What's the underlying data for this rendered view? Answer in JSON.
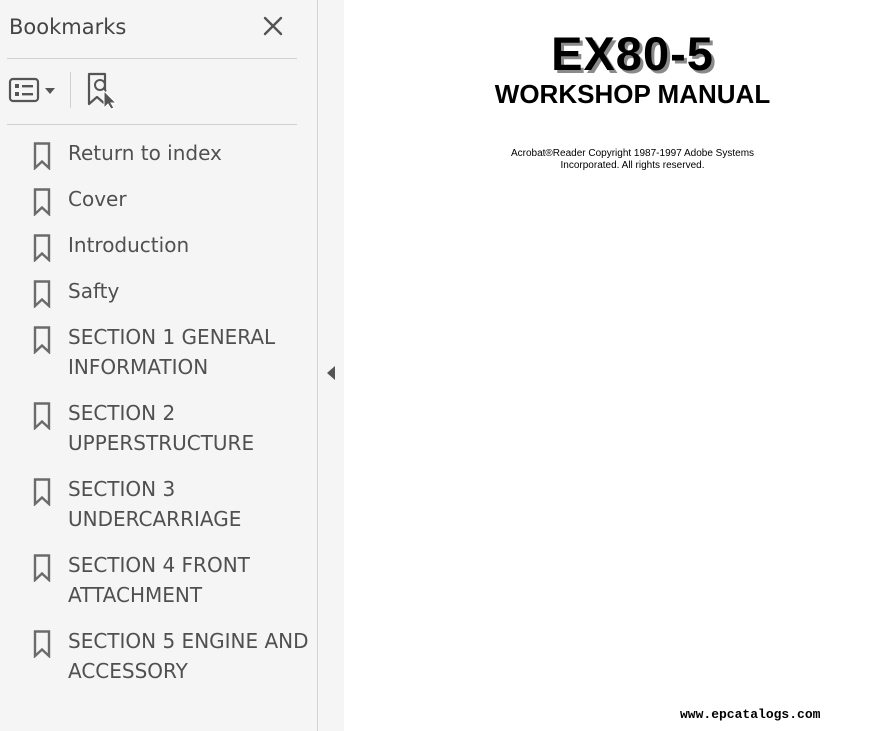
{
  "sidebar": {
    "title": "Bookmarks",
    "close_icon": "close-icon",
    "toolbar": {
      "options_icon": "bookmark-options-icon",
      "dropdown_icon": "chevron-down-icon",
      "find_icon": "find-current-bookmark-icon"
    },
    "items": [
      {
        "label_lines": [
          "Return to index"
        ]
      },
      {
        "label_lines": [
          "Cover"
        ]
      },
      {
        "label_lines": [
          "Introduction"
        ]
      },
      {
        "label_lines": [
          "Safty"
        ]
      },
      {
        "label_lines": [
          "SECTION 1 GENERAL",
          "INFORMATION"
        ]
      },
      {
        "label_lines": [
          "SECTION 2",
          "UPPERSTRUCTURE"
        ]
      },
      {
        "label_lines": [
          "SECTION 3",
          "UNDERCARRIAGE"
        ]
      },
      {
        "label_lines": [
          "SECTION 4 FRONT",
          "ATTACHMENT"
        ]
      },
      {
        "label_lines": [
          "SECTION 5 ENGINE AND",
          "ACCESSORY"
        ]
      }
    ]
  },
  "collapse_icon": "triangle-left-icon",
  "document": {
    "title": "EX80-5",
    "subtitle": "WORKSHOP MANUAL",
    "copyright_line1": "Acrobat®Reader Copyright 1987-1997 Adobe Systems",
    "copyright_line2": "Incorporated. All rights reserved.",
    "url": "www.epcatalogs.com"
  },
  "colors": {
    "sidebar_bg": "#f5f5f5",
    "sidebar_text": "#505050",
    "icon_gray": "#6b6b6b"
  }
}
